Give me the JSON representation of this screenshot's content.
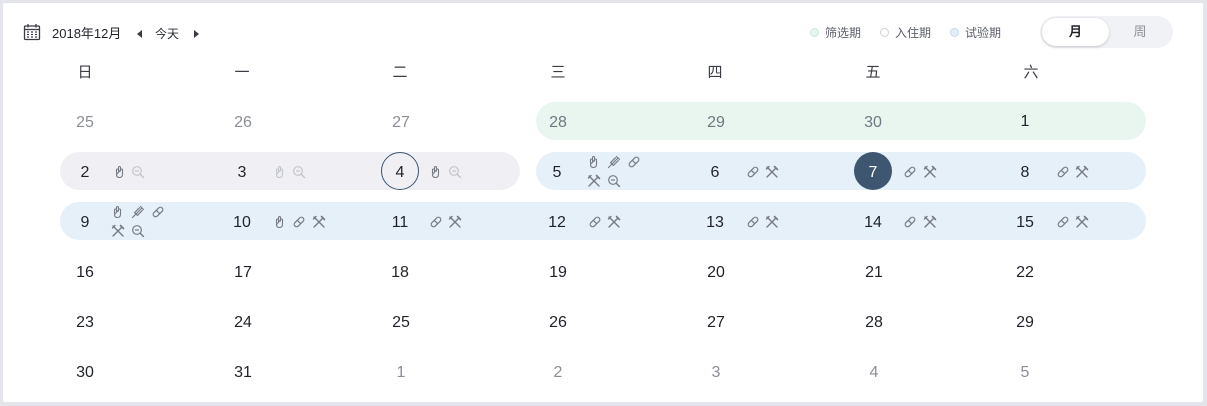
{
  "header": {
    "month_title": "2018年12月",
    "today_label": "今天",
    "icons": {
      "calendar": "calendar-icon",
      "prev": "caret-left-icon",
      "next": "caret-right-icon"
    }
  },
  "legend": [
    {
      "label": "筛选期",
      "fill": "#e6f5ee",
      "border": "#c9e8d8"
    },
    {
      "label": "入住期",
      "fill": "#ffffff",
      "border": "#cfd1d6"
    },
    {
      "label": "试验期",
      "fill": "#e4eef8",
      "border": "#c7d9ec"
    }
  ],
  "view_toggle": {
    "month_label": "月",
    "week_label": "周",
    "selected": "月"
  },
  "weekdays": [
    "日",
    "一",
    "二",
    "三",
    "四",
    "五",
    "六"
  ],
  "colors": {
    "screening": "#e9f6ef",
    "checkin": "#f0f0f4",
    "trial": "#e6f0f9",
    "selected_day": "#3e5670",
    "accent": "#3e5670"
  },
  "weeks": [
    [
      "25",
      "26",
      "27",
      "28",
      "29",
      "30",
      "1"
    ],
    [
      "2",
      "3",
      "4",
      "5",
      "6",
      "7",
      "8"
    ],
    [
      "9",
      "10",
      "11",
      "12",
      "13",
      "14",
      "15"
    ],
    [
      "16",
      "17",
      "18",
      "19",
      "20",
      "21",
      "22"
    ],
    [
      "23",
      "24",
      "25",
      "26",
      "27",
      "28",
      "29"
    ],
    [
      "30",
      "31",
      "1",
      "2",
      "3",
      "4",
      "5"
    ]
  ],
  "today_date": "4",
  "selected_date": "7",
  "icon_names": [
    "hand-icon",
    "zoom-out-icon",
    "syringe-icon",
    "pill-icon",
    "tools-icon"
  ]
}
